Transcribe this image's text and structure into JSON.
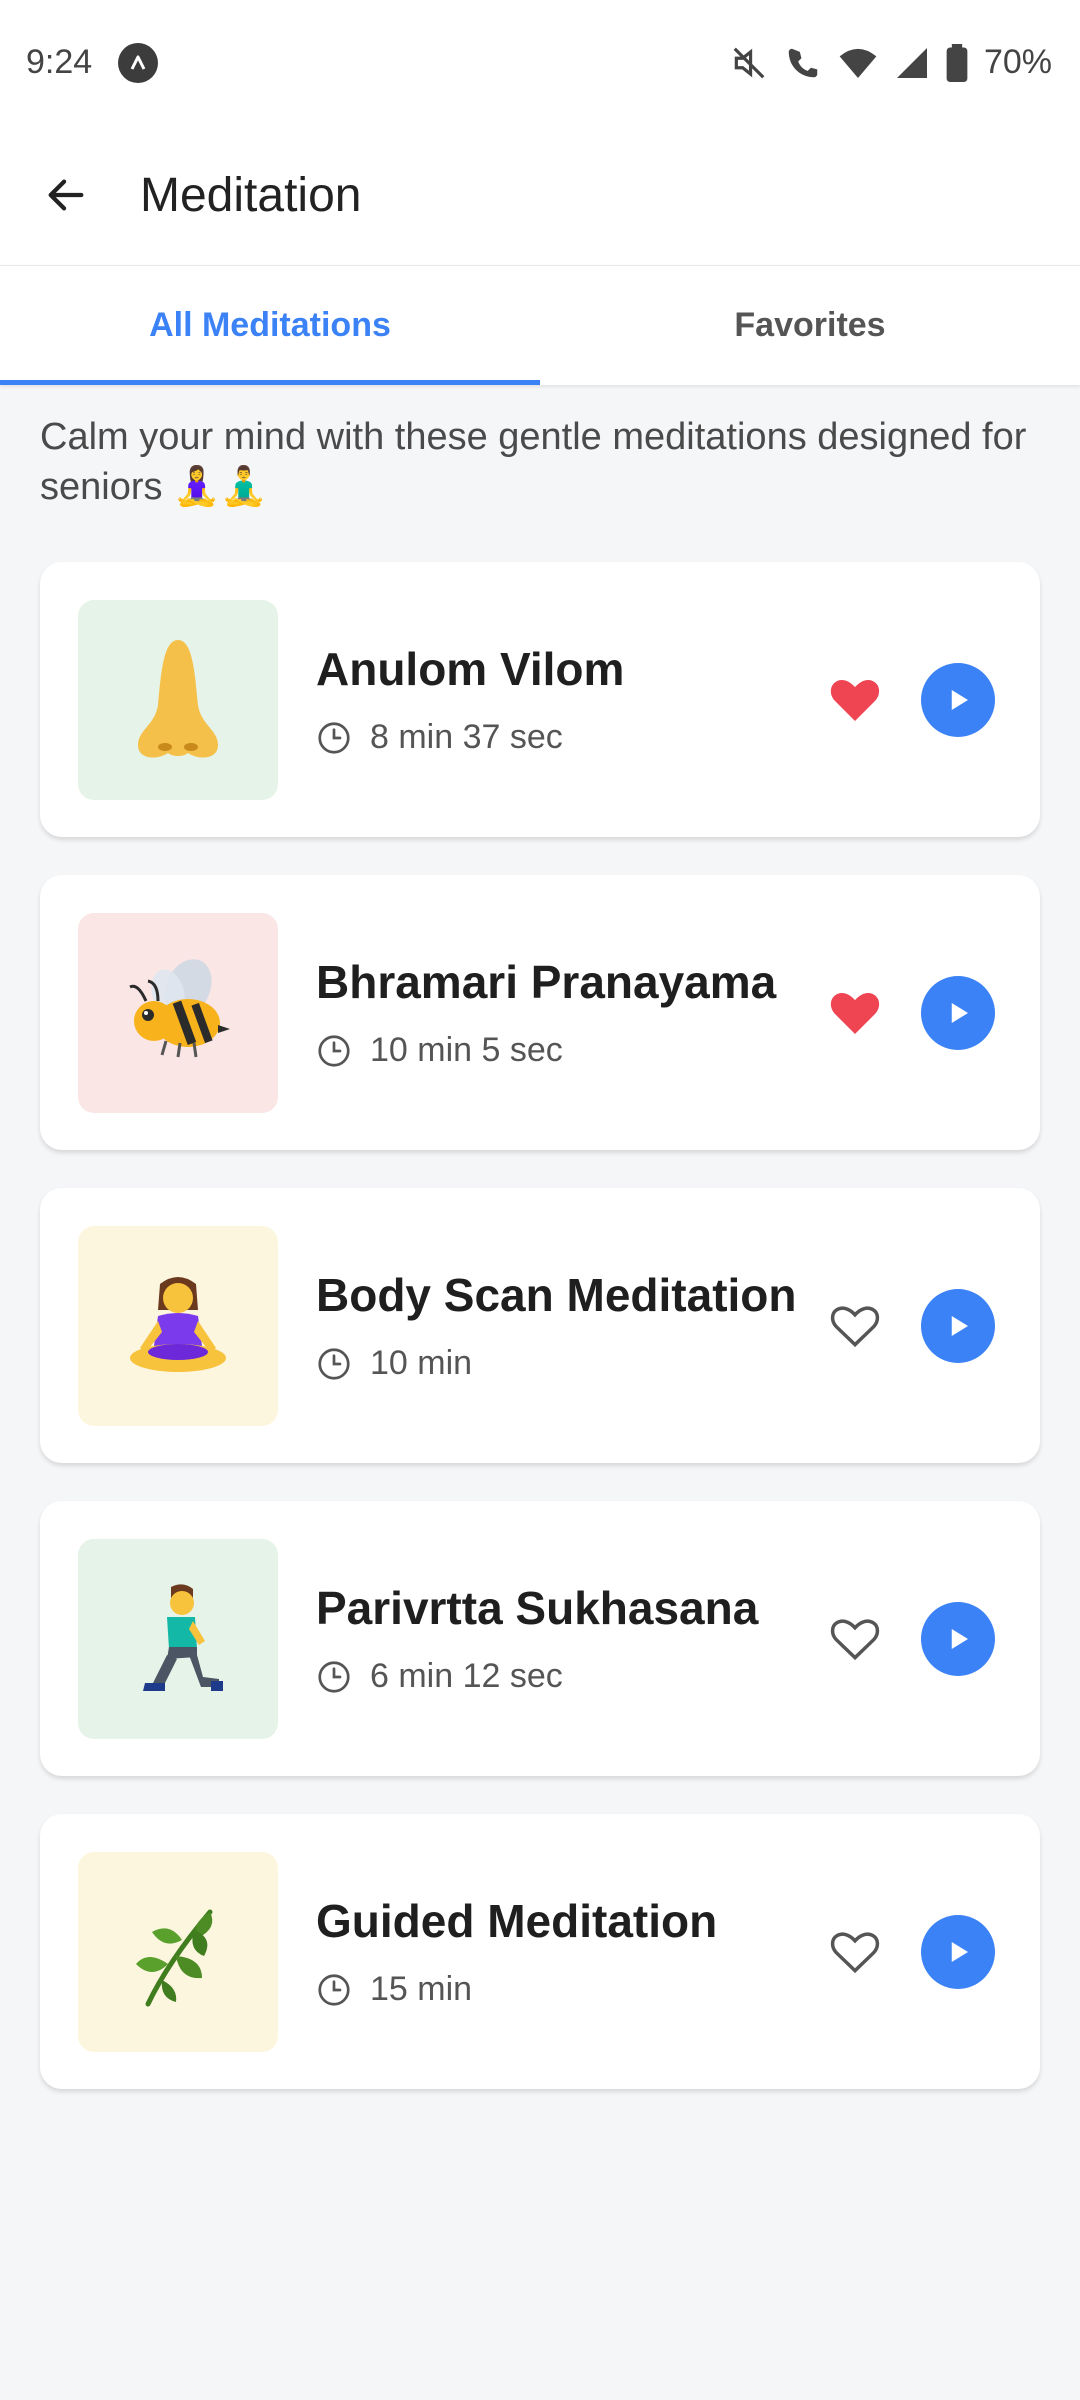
{
  "status_bar": {
    "time": "9:24",
    "battery": "70%",
    "icons": [
      "app-badge-icon",
      "mute-icon",
      "wifi-calling-icon",
      "wifi-icon",
      "signal-icon",
      "battery-icon"
    ]
  },
  "header": {
    "title": "Meditation"
  },
  "tabs": [
    {
      "label": "All Meditations",
      "active": true
    },
    {
      "label": "Favorites",
      "active": false
    }
  ],
  "intro": {
    "text": "Calm your mind with these gentle meditations designed for seniors 🧘‍♀️🧘‍♂️"
  },
  "meditations": [
    {
      "title": "Anulom Vilom",
      "duration": "8 min 37 sec",
      "icon": "nose-icon",
      "thumb_bg": "#e6f3e8",
      "favorite": true
    },
    {
      "title": "Bhramari Pranayama",
      "duration": "10 min 5 sec",
      "icon": "bee-icon",
      "thumb_bg": "#fbe6e6",
      "favorite": true
    },
    {
      "title": "Body Scan Meditation",
      "duration": "10 min",
      "icon": "meditating-woman-icon",
      "thumb_bg": "#fdf6df",
      "favorite": false
    },
    {
      "title": "Parivrtta Sukhasana",
      "duration": "6 min 12 sec",
      "icon": "kneeling-man-icon",
      "thumb_bg": "#e6f3e8",
      "favorite": false
    },
    {
      "title": "Guided Meditation",
      "duration": "15 min",
      "icon": "herb-icon",
      "thumb_bg": "#fdf6df",
      "favorite": false
    }
  ],
  "colors": {
    "accent": "#3b82f6",
    "favorite_active": "#ef4452",
    "background": "#f5f6f8"
  }
}
